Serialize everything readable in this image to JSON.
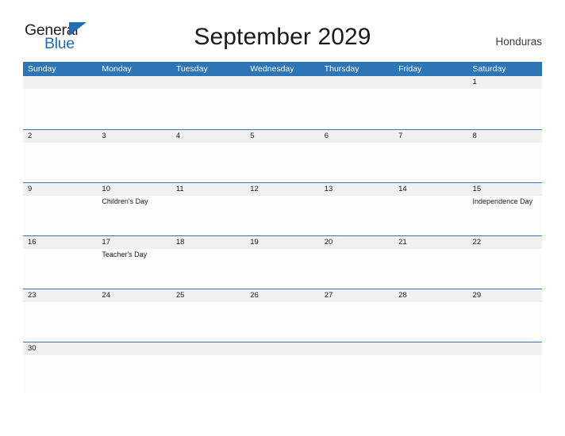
{
  "logo": {
    "word_top": "General",
    "word_bottom": "Blue",
    "accent_color": "#1f6fb5"
  },
  "header": {
    "title": "September 2029",
    "country": "Honduras"
  },
  "theme": {
    "header_blue": "#2e75b6",
    "row_shade": "#f0f0f0",
    "cell_white": "#fdfdfd",
    "text": "#1a1a1a"
  },
  "calendar": {
    "weekdays": [
      "Sunday",
      "Monday",
      "Tuesday",
      "Wednesday",
      "Thursday",
      "Friday",
      "Saturday"
    ],
    "weeks": [
      {
        "days": [
          {
            "num": "",
            "event": ""
          },
          {
            "num": "",
            "event": ""
          },
          {
            "num": "",
            "event": ""
          },
          {
            "num": "",
            "event": ""
          },
          {
            "num": "",
            "event": ""
          },
          {
            "num": "",
            "event": ""
          },
          {
            "num": "1",
            "event": ""
          }
        ]
      },
      {
        "days": [
          {
            "num": "2",
            "event": ""
          },
          {
            "num": "3",
            "event": ""
          },
          {
            "num": "4",
            "event": ""
          },
          {
            "num": "5",
            "event": ""
          },
          {
            "num": "6",
            "event": ""
          },
          {
            "num": "7",
            "event": ""
          },
          {
            "num": "8",
            "event": ""
          }
        ]
      },
      {
        "days": [
          {
            "num": "9",
            "event": ""
          },
          {
            "num": "10",
            "event": "Children's Day"
          },
          {
            "num": "11",
            "event": ""
          },
          {
            "num": "12",
            "event": ""
          },
          {
            "num": "13",
            "event": ""
          },
          {
            "num": "14",
            "event": ""
          },
          {
            "num": "15",
            "event": "Independence Day"
          }
        ]
      },
      {
        "days": [
          {
            "num": "16",
            "event": ""
          },
          {
            "num": "17",
            "event": "Teacher's Day"
          },
          {
            "num": "18",
            "event": ""
          },
          {
            "num": "19",
            "event": ""
          },
          {
            "num": "20",
            "event": ""
          },
          {
            "num": "21",
            "event": ""
          },
          {
            "num": "22",
            "event": ""
          }
        ]
      },
      {
        "days": [
          {
            "num": "23",
            "event": ""
          },
          {
            "num": "24",
            "event": ""
          },
          {
            "num": "25",
            "event": ""
          },
          {
            "num": "26",
            "event": ""
          },
          {
            "num": "27",
            "event": ""
          },
          {
            "num": "28",
            "event": ""
          },
          {
            "num": "29",
            "event": ""
          }
        ]
      },
      {
        "days": [
          {
            "num": "30",
            "event": ""
          },
          {
            "num": "",
            "event": ""
          },
          {
            "num": "",
            "event": ""
          },
          {
            "num": "",
            "event": ""
          },
          {
            "num": "",
            "event": ""
          },
          {
            "num": "",
            "event": ""
          },
          {
            "num": "",
            "event": ""
          }
        ]
      }
    ]
  }
}
